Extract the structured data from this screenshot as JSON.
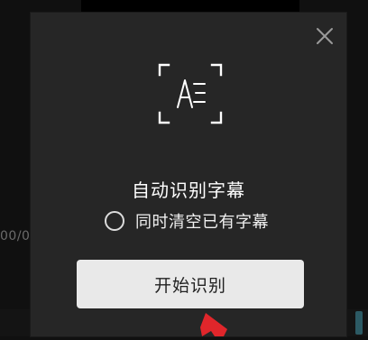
{
  "background": {
    "timecode_fragment": "00/0"
  },
  "dialog": {
    "title": "自动识别字幕",
    "option": {
      "label": "同时清空已有字幕",
      "checked": false
    },
    "start_button_label": "开始识别",
    "icons": {
      "close": "close-icon",
      "scan": "text-recognition-icon"
    }
  },
  "colors": {
    "dialog_background": "#262626",
    "button_background": "#e9e9e9",
    "annotation_arrow": "#e0262b"
  }
}
